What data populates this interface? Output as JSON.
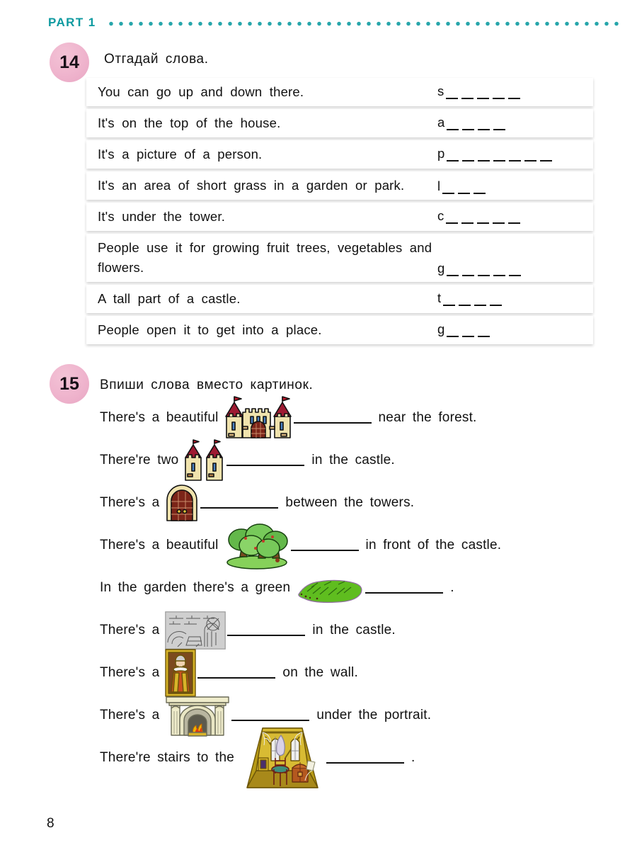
{
  "header": {
    "part_label": "PART 1",
    "rule_color": "#27a6ab"
  },
  "page_number": "8",
  "exercises": [
    {
      "number": "14",
      "title": "Отгадай слова.",
      "rows": [
        {
          "clue": "You can go up and down there.",
          "letter": "s",
          "blanks": 5
        },
        {
          "clue": "It's on the top of the house.",
          "letter": "a",
          "blanks": 4
        },
        {
          "clue": "It's a picture of a person.",
          "letter": "p",
          "blanks": 7
        },
        {
          "clue": "It's an area of short grass in a garden or park.",
          "letter": "l",
          "blanks": 3,
          "tall": true
        },
        {
          "clue": "It's under the tower.",
          "letter": "c",
          "blanks": 5
        },
        {
          "clue": "People use it for growing fruit trees, vegetables and flowers.",
          "letter": "g",
          "blanks": 5,
          "tall": true
        },
        {
          "clue": "A tall part of a castle.",
          "letter": "t",
          "blanks": 4
        },
        {
          "clue": "People open it to get into a place.",
          "letter": "g",
          "blanks": 3
        }
      ]
    },
    {
      "number": "15",
      "title": "Впиши слова вместо картинок.",
      "sentences": [
        {
          "pre": "There's a beautiful",
          "icon": "castle-icon",
          "post": "near the forest.",
          "blank_width": 110
        },
        {
          "pre": "There're two",
          "icon": "two-towers-icon",
          "post": "in the castle.",
          "blank_width": 110
        },
        {
          "pre": "There's a",
          "icon": "gate-icon",
          "post": "between the towers.",
          "blank_width": 110
        },
        {
          "pre": "There's a beautiful",
          "icon": "garden-trees-icon",
          "post": "in front of the castle.",
          "blank_width": 96
        },
        {
          "pre": "In the garden there's a green",
          "icon": "lawn-icon",
          "post": ".",
          "blank_width": 110
        },
        {
          "pre": "There's a",
          "icon": "cellar-icon",
          "post": "in the castle.",
          "blank_width": 110
        },
        {
          "pre": "There's a",
          "icon": "portrait-icon",
          "post": "on the wall.",
          "blank_width": 110
        },
        {
          "pre": "There's a",
          "icon": "fireplace-icon",
          "post": "under the portrait.",
          "blank_width": 110
        },
        {
          "pre": "There're stairs to the",
          "icon": "attic-icon",
          "post": ".",
          "blank_width": 110
        }
      ]
    }
  ],
  "colors": {
    "badge_pink": "#efb4cd",
    "teal": "#0e9aa0",
    "castle_wall": "#f0e3ad",
    "castle_roof": "#9e1b32",
    "flag_red": "#c0192b",
    "door_brown": "#7b2418",
    "tree_green": "#63b84a",
    "lawn_green": "#5fbd1f",
    "stone_grey": "#d3d3d3",
    "portrait_gold": "#c9a227",
    "attic_gold": "#b79a16"
  }
}
